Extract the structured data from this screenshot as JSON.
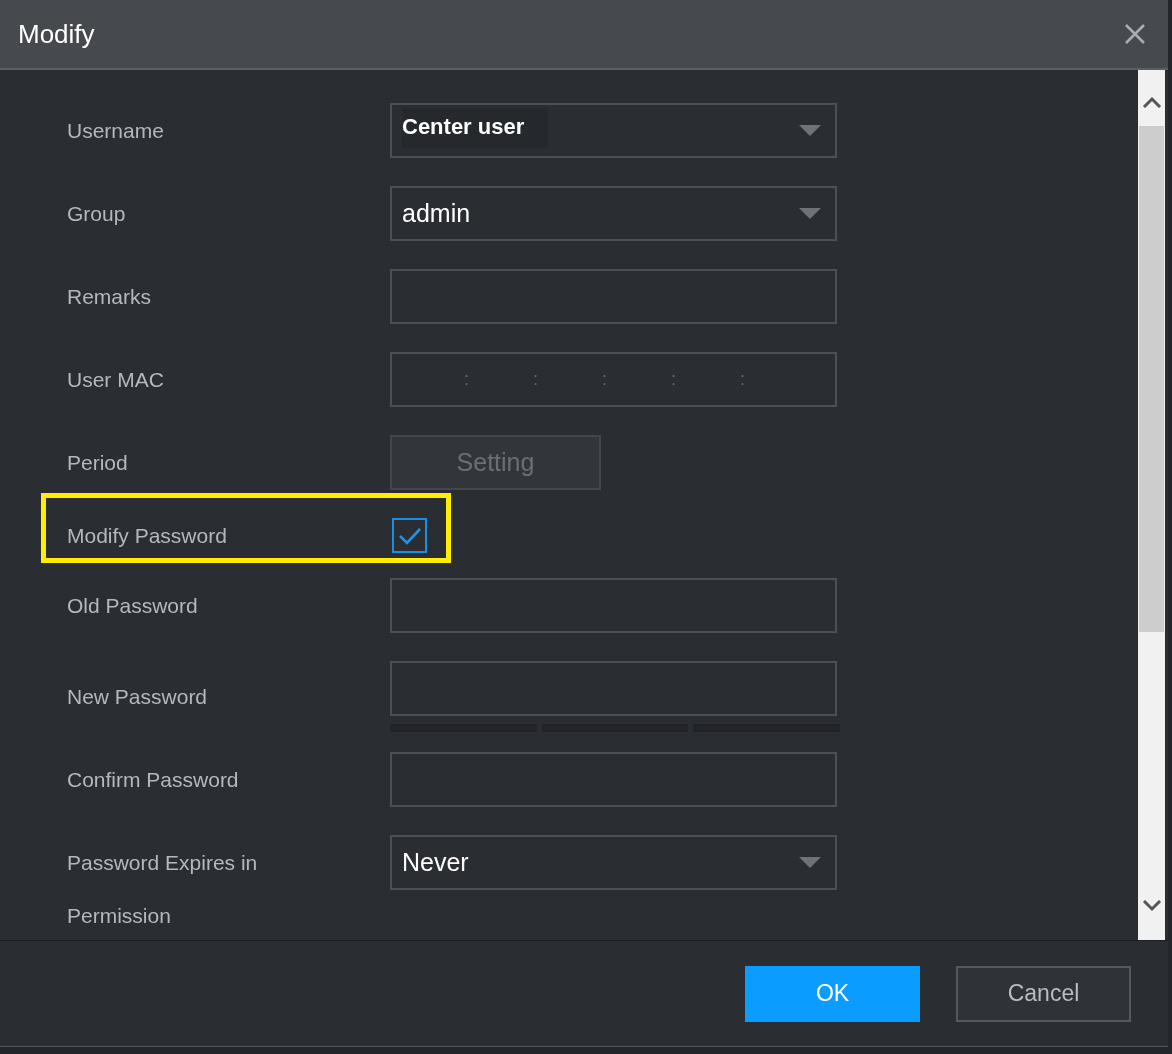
{
  "window": {
    "title": "Modify"
  },
  "rows": [
    {
      "kind": "select",
      "label": "Username",
      "value": "Center user",
      "bold": true
    },
    {
      "kind": "select",
      "label": "Group",
      "value": "admin",
      "bold": false
    },
    {
      "kind": "text",
      "label": "Remarks",
      "value": ""
    },
    {
      "kind": "mac",
      "label": "User MAC",
      "separators": [
        ":",
        ":",
        ":",
        ":",
        ":"
      ]
    },
    {
      "kind": "button",
      "label": "Period",
      "button": "Setting",
      "disabled": true
    },
    {
      "kind": "checkbox",
      "label": "Modify Password",
      "checked": true,
      "highlighted": true
    },
    {
      "kind": "password",
      "label": "Old Password",
      "strength_meter": false
    },
    {
      "kind": "password",
      "label": "New Password",
      "strength_meter": true
    },
    {
      "kind": "password",
      "label": "Confirm Password",
      "strength_meter": false
    },
    {
      "kind": "select",
      "label": "Password Expires in",
      "value": "Never",
      "bold": false
    },
    {
      "kind": "heading",
      "label": "Permission"
    }
  ],
  "buttons": [
    {
      "label": "OK",
      "primary": true
    },
    {
      "label": "Cancel",
      "primary": false
    }
  ]
}
